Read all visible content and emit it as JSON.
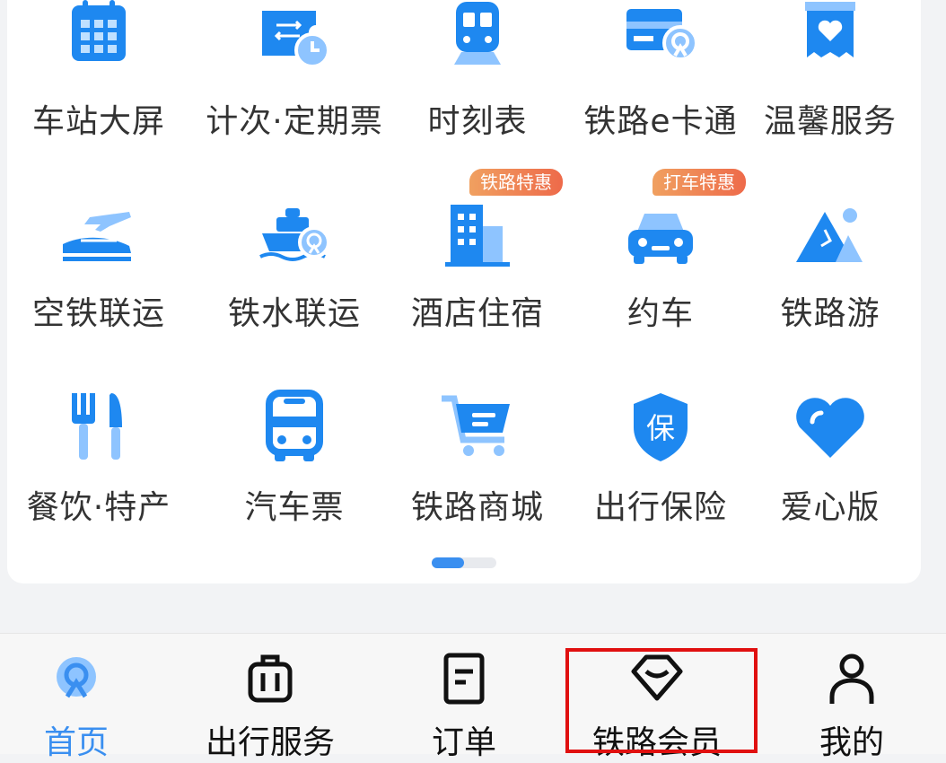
{
  "grid": {
    "items": [
      {
        "label": "车站大屏",
        "icon": "station-screen-icon"
      },
      {
        "label": "计次·定期票",
        "icon": "ticket-clock-icon"
      },
      {
        "label": "时刻表",
        "icon": "train-icon"
      },
      {
        "label": "铁路e卡通",
        "icon": "rail-card-icon"
      },
      {
        "label": "温馨服务",
        "icon": "heart-box-icon"
      },
      {
        "label": "空铁联运",
        "icon": "plane-train-icon"
      },
      {
        "label": "铁水联运",
        "icon": "ship-icon"
      },
      {
        "label": "酒店住宿",
        "icon": "hotel-icon",
        "badge": "铁路特惠"
      },
      {
        "label": "约车",
        "icon": "car-icon",
        "badge": "打车特惠"
      },
      {
        "label": "铁路游",
        "icon": "mountain-icon"
      },
      {
        "label": "餐饮·特产",
        "icon": "fork-knife-icon"
      },
      {
        "label": "汽车票",
        "icon": "bus-icon"
      },
      {
        "label": "铁路商城",
        "icon": "cart-icon"
      },
      {
        "label": "出行保险",
        "icon": "shield-icon",
        "shield_char": "保"
      },
      {
        "label": "爱心版",
        "icon": "heart-icon"
      }
    ],
    "pager": {
      "page": 1,
      "total": 2
    }
  },
  "tabbar": {
    "tabs": [
      {
        "label": "首页",
        "icon": "railway-logo-icon",
        "active": true
      },
      {
        "label": "出行服务",
        "icon": "luggage-icon",
        "active": false
      },
      {
        "label": "订单",
        "icon": "order-doc-icon",
        "active": false
      },
      {
        "label": "铁路会员",
        "icon": "diamond-icon",
        "active": false,
        "highlighted": true
      },
      {
        "label": "我的",
        "icon": "user-icon",
        "active": false
      }
    ]
  },
  "colors": {
    "accent": "#3a8ff0",
    "icon_blue": "#1e88f0",
    "icon_light": "#8ec4ff",
    "badge": "#ee6a4a",
    "highlight": "#e01010"
  }
}
